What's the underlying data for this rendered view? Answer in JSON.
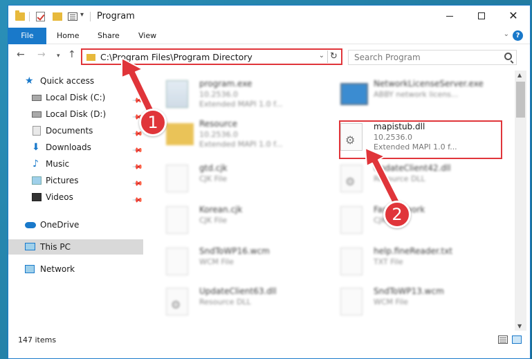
{
  "window": {
    "title": "Program"
  },
  "ribbon": {
    "file": "File",
    "home": "Home",
    "share": "Share",
    "view": "View",
    "help": "?"
  },
  "address": {
    "path": "C:\\Program Files\\Program Directory"
  },
  "search": {
    "placeholder": "Search Program"
  },
  "nav": {
    "items": [
      {
        "label": "Quick access",
        "icon": "star-icon"
      },
      {
        "label": "Local Disk (C:)",
        "icon": "disk-icon"
      },
      {
        "label": "Local Disk (D:)",
        "icon": "disk-icon"
      },
      {
        "label": "Documents",
        "icon": "documents-icon"
      },
      {
        "label": "Downloads",
        "icon": "download-icon"
      },
      {
        "label": "Music",
        "icon": "music-icon"
      },
      {
        "label": "Pictures",
        "icon": "pictures-icon"
      },
      {
        "label": "Videos",
        "icon": "videos-icon"
      },
      {
        "label": "OneDrive",
        "icon": "cloud-icon"
      },
      {
        "label": "This PC",
        "icon": "pc-icon"
      },
      {
        "label": "Network",
        "icon": "network-icon"
      }
    ]
  },
  "files": [
    {
      "name": "program.exe",
      "line2": "10.2536.0",
      "line3": "Extended MAPI 1.0 f..."
    },
    {
      "name": "NetworkLicenseServer.exe",
      "line2": "ABBY network licens...",
      "line3": ""
    },
    {
      "name": "Resource",
      "line2": "10.2536.0",
      "line3": "Extended MAPI 1.0 f..."
    },
    {
      "name": "mapistub.dll",
      "line2": "10.2536.0",
      "line3": "Extended MAPI 1.0 f..."
    },
    {
      "name": "gtd.cjk",
      "line2": "CJK File",
      "line3": ""
    },
    {
      "name": "UpdateClient42.dll",
      "line2": "Resource DLL",
      "line3": ""
    },
    {
      "name": "Korean.cjk",
      "line2": "CJK File",
      "line3": ""
    },
    {
      "name": "FastNetwork",
      "line2": "CJK File",
      "line3": ""
    },
    {
      "name": "SndToWP16.wcm",
      "line2": "WCM File",
      "line3": ""
    },
    {
      "name": "help.fineReader.txt",
      "line2": "TXT File",
      "line3": ""
    },
    {
      "name": "UpdateClient63.dll",
      "line2": "Resource DLL",
      "line3": ""
    },
    {
      "name": "SndToWP13.wcm",
      "line2": "WCM File",
      "line3": ""
    }
  ],
  "status": {
    "count": "147 items"
  },
  "callouts": {
    "one": "1",
    "two": "2"
  },
  "colors": {
    "accent": "#1979ca",
    "highlight": "#e0353a",
    "folder": "#e7b93c"
  }
}
